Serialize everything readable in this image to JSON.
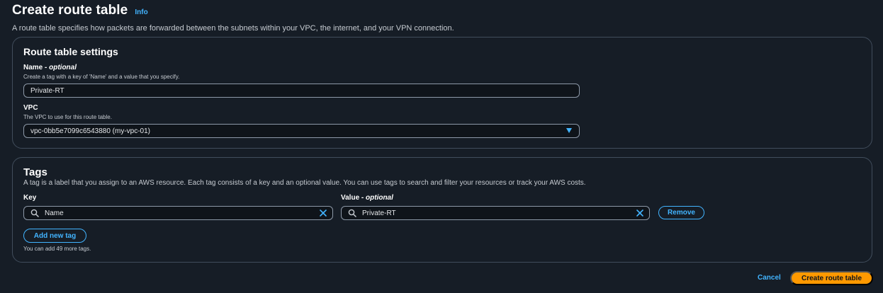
{
  "header": {
    "title": "Create route table",
    "info": "Info",
    "description": "A route table specifies how packets are forwarded between the subnets within your VPC, the internet, and your VPN connection."
  },
  "settings": {
    "heading": "Route table settings",
    "name_label": "Name - ",
    "name_optional": "optional",
    "name_help": "Create a tag with a key of 'Name' and a value that you specify.",
    "name_value": "Private-RT",
    "vpc_label": "VPC",
    "vpc_help": "The VPC to use for this route table.",
    "vpc_value": "vpc-0bb5e7099c6543880 (my-vpc-01)"
  },
  "tags": {
    "heading": "Tags",
    "description": "A tag is a label that you assign to an AWS resource. Each tag consists of a key and an optional value. You can use tags to search and filter your resources or track your AWS costs.",
    "key_label": "Key",
    "value_label": "Value - ",
    "value_optional": "optional",
    "rows": [
      {
        "key": "Name",
        "value": "Private-RT",
        "remove_label": "Remove"
      }
    ],
    "add_label": "Add new tag",
    "remaining_note": "You can add 49 more tags."
  },
  "footer": {
    "cancel_label": "Cancel",
    "create_label": "Create route table"
  },
  "colors": {
    "background": "#161d26",
    "accent": "#42b4ff",
    "primary": "#ff9900",
    "border": "#414d5c"
  }
}
